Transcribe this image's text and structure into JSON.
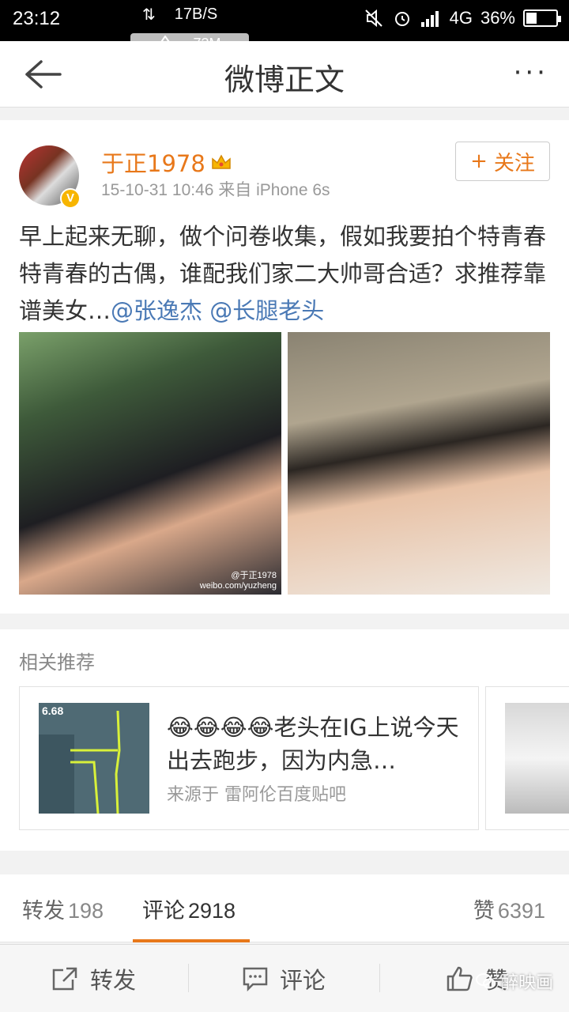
{
  "status_bar": {
    "time": "23:12",
    "net_arrows": "⇅",
    "net_speed": "17B/S",
    "memory": "73M",
    "network_type": "4G",
    "battery": "36%",
    "battery_level": 0.36
  },
  "header": {
    "title": "微博正文",
    "more": "···"
  },
  "post": {
    "username": "于正1978",
    "meta": "15-10-31 10:46  来自 iPhone 6s",
    "verified_badge": "V",
    "follow_plus": "+",
    "follow_label": "关注",
    "text": "早上起来无聊，做个问卷收集，假如我要拍个特青春特青春的古偶，谁配我们家二大帅哥合适？求推荐靠谱美女…",
    "mentions": [
      "@张逸杰",
      "@长腿老头"
    ],
    "image1_watermark": [
      "@于正1978",
      "weibo.com/yuzheng"
    ]
  },
  "related": {
    "title": "相关推荐",
    "card": {
      "thumb_text": "6.68",
      "emoji": "😂😂😂😂",
      "text": "老头在IG上说今天出去跑步，因为内急…",
      "source": "来源于 雷阿伦百度贴吧"
    }
  },
  "stats": {
    "repost_label": "转发",
    "repost_count": "198",
    "comment_label": "评论",
    "comment_count": "2918",
    "like_label": "赞",
    "like_count": "6391"
  },
  "actions": {
    "repost": "转发",
    "comment": "评论",
    "like": "赞",
    "watermark": "醉映画"
  },
  "colors": {
    "accent": "#e8781a",
    "link": "#4a79b5"
  }
}
